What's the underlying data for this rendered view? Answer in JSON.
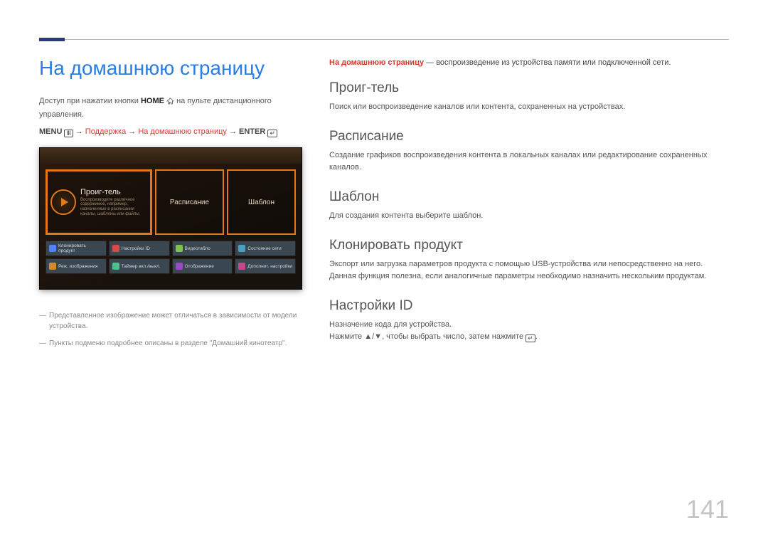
{
  "pageNumber": "141",
  "left": {
    "title": "На домашнюю страницу",
    "access_pre": "Доступ при нажатии кнопки ",
    "access_bold": "HOME",
    "access_post": " на пульте дистанционного управления.",
    "menu_label": "MENU",
    "path_step1": "Поддержка",
    "path_step2": "На домашнюю страницу",
    "path_enter": "ENTER",
    "arrow": "→",
    "ss": {
      "tile1_title": "Проиг-тель",
      "tile1_sub": "Воспроизводите различное содержимое, например, назначенные в расписании каналы, шаблоны или файлы.",
      "tile2": "Расписание",
      "tile3": "Шаблон",
      "cells": [
        "Клонировать продукт",
        "Настройки ID",
        "Видеотабло",
        "Состояние сети",
        "Реж. изображения",
        "Таймер вкл./выкл.",
        "Отображение",
        "Дополнит. настройки"
      ],
      "cell_colors": [
        "#5282ff",
        "#d64a4a",
        "#7dc24a",
        "#4aa0c2",
        "#d68a2a",
        "#4ac28a",
        "#9a4ac2",
        "#c24a8a"
      ]
    },
    "note1": "Представленное изображение может отличаться в зависимости от модели устройства.",
    "note2": "Пункты подменю подробнее описаны в разделе \"Домашний кинотеатр\"."
  },
  "right": {
    "lead_bold": "На домашнюю страницу",
    "lead_rest": " — воспроизведение из устройства памяти или подключенной сети.",
    "sections": [
      {
        "h": "Проиг-тель",
        "p": "Поиск или воспроизведение каналов или контента, сохраненных на устройствах."
      },
      {
        "h": "Расписание",
        "p": "Создание графиков воспроизведения контента в локальных каналах или редактирование сохраненных каналов."
      },
      {
        "h": "Шаблон",
        "p": "Для создания контента выберите шаблон."
      },
      {
        "h": "Клонировать продукт",
        "p": "Экспорт или загрузка параметров продукта с помощью USB-устройства или непосредственно на него. Данная функция полезна, если аналогичные параметры необходимо назначить нескольким продуктам."
      },
      {
        "h": "Настройки ID",
        "p1": "Назначение кода для устройства.",
        "p2_pre": "Нажмите ",
        "p2_mid": "▲/▼",
        "p2_mid2": ", чтобы выбрать число, затем нажмите ",
        "p2_enter_glyph": "↵",
        "p2_post": "."
      }
    ]
  }
}
